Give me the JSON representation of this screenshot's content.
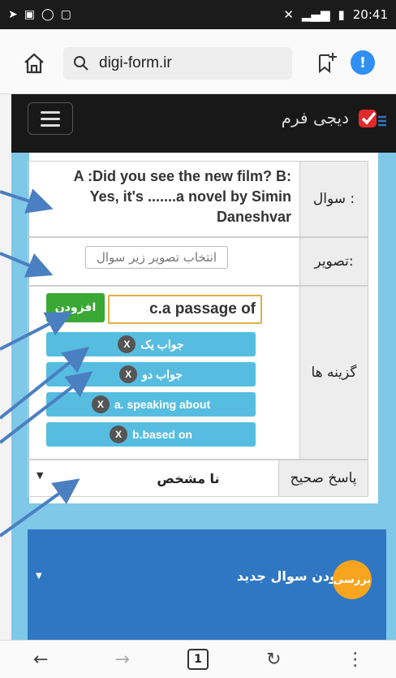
{
  "status_bar": {
    "time": "20:41"
  },
  "browser": {
    "url": "digi-form.ir"
  },
  "site": {
    "brand_name": "دیجی فرم"
  },
  "form": {
    "question_label": "سوال :",
    "question_text": "A :Did you see the new film? B: Yes, it's .......a novel by Simin Daneshvar",
    "image_label": "تصویر:",
    "image_select": "انتخاب تصویر زیر سوال",
    "options_label": "گزینه ها",
    "add_button": "افزودن",
    "answer_input": "c.a passage of",
    "options": [
      {
        "text": "جواب یک",
        "remove": "X"
      },
      {
        "text": "جواب دو",
        "remove": "X"
      },
      {
        "text": "a. speaking about",
        "remove": "X"
      },
      {
        "text": "b.based on",
        "remove": "X"
      }
    ],
    "correct_label": "پاسخ صحیح",
    "correct_value": "نا مشخص"
  },
  "panel": {
    "title": "ودن سوال جدید",
    "review_button": "بررسی"
  },
  "bottom_nav": {
    "tab_count": "1"
  },
  "colors": {
    "arrow": "#4a7fc1",
    "add_button": "#3aa835",
    "chip": "#56bde0",
    "panel": "#2f77c2",
    "review": "#f7a51e"
  }
}
